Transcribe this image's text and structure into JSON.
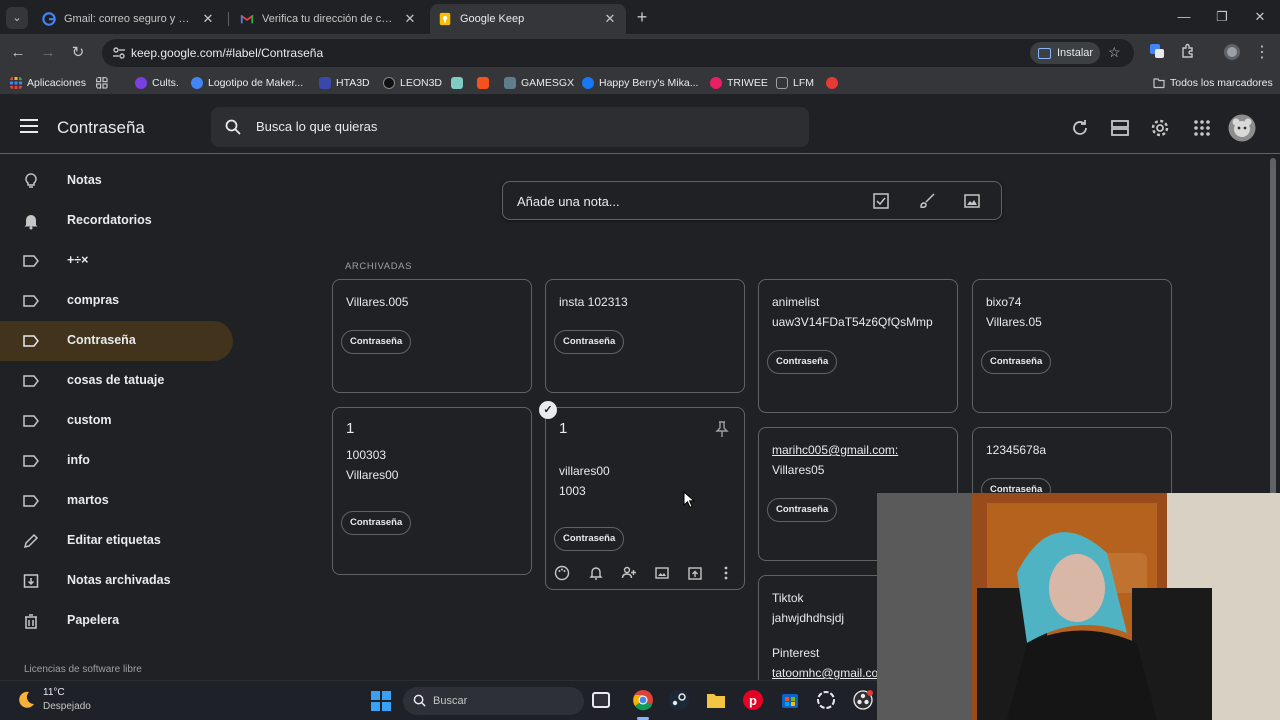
{
  "browser": {
    "tabs": [
      {
        "title": "Gmail: correo seguro y basado",
        "icon": "google-icon"
      },
      {
        "title": "Verifica tu dirección de correo e",
        "icon": "gmail-icon"
      },
      {
        "title": "Google Keep",
        "icon": "keep-icon",
        "active": true
      }
    ],
    "url": "keep.google.com/#label/Contraseña",
    "install_label": "Instalar",
    "bookmarks": [
      {
        "label": "Aplicaciones",
        "icon": "apps-grid-icon"
      },
      {
        "label": "",
        "icon": "grid-icon"
      },
      {
        "label": "Cults.",
        "icon": "cults-icon"
      },
      {
        "label": "Logotipo de Maker...",
        "icon": "maker-icon"
      },
      {
        "label": "HTA3D",
        "icon": "hta3d-icon"
      },
      {
        "label": "LEON3D",
        "icon": "leon3d-icon"
      },
      {
        "label": "",
        "icon": "antenna-icon"
      },
      {
        "label": "",
        "icon": "orange-square-icon"
      },
      {
        "label": "GAMESGX",
        "icon": "gamesgx-icon"
      },
      {
        "label": "Happy Berry's Mika...",
        "icon": "facebook-icon"
      },
      {
        "label": "TRIWEE",
        "icon": "triwee-icon"
      },
      {
        "label": "LFM",
        "icon": "lfm-icon"
      },
      {
        "label": "",
        "icon": "red-circle-icon"
      }
    ],
    "all_bookmarks_label": "Todos los marcadores"
  },
  "keep": {
    "title": "Contraseña",
    "search_placeholder": "Busca lo que quieras",
    "take_note_placeholder": "Añade una nota...",
    "section_label": "ARCHIVADAS",
    "sidebar": [
      {
        "label": "Notas",
        "icon": "lightbulb-icon"
      },
      {
        "label": "Recordatorios",
        "icon": "bell-icon"
      },
      {
        "label": "+÷×",
        "icon": "label-icon"
      },
      {
        "label": "compras",
        "icon": "label-icon"
      },
      {
        "label": "Contraseña",
        "icon": "label-icon",
        "active": true
      },
      {
        "label": "cosas de tatuaje",
        "icon": "label-icon"
      },
      {
        "label": "custom",
        "icon": "label-icon"
      },
      {
        "label": "info",
        "icon": "label-icon"
      },
      {
        "label": "martos",
        "icon": "label-icon"
      },
      {
        "label": "Editar etiquetas",
        "icon": "pencil-icon"
      },
      {
        "label": "Notas archivadas",
        "icon": "archive-icon"
      },
      {
        "label": "Papelera",
        "icon": "trash-icon"
      }
    ],
    "licenses_label": "Licencias de software libre",
    "chip_label": "Contraseña",
    "notes": [
      {
        "title": "",
        "lines": [
          "Villares.005"
        ]
      },
      {
        "title": "",
        "lines": [
          "insta 102313"
        ]
      },
      {
        "title": "",
        "lines": [
          "animelist",
          "uaw3V14FDaT54z6QfQsMmp"
        ]
      },
      {
        "title": "",
        "lines": [
          "bixo74",
          "Villares.05"
        ]
      },
      {
        "title": "1",
        "lines": [
          "100303",
          "Villares00"
        ]
      },
      {
        "title": "1",
        "lines": [
          "villares00",
          "1003"
        ],
        "selected": true
      },
      {
        "title": "",
        "lines": [
          "marihc005@gmail.com:",
          "Villares05"
        ]
      },
      {
        "title": "",
        "lines": [
          "12345678a"
        ]
      },
      {
        "title": "",
        "lines": [
          "Tiktok",
          "jahwjdhdhsjdj",
          "",
          "Pinterest",
          "tatoomhc@gmail.co"
        ]
      }
    ]
  },
  "taskbar": {
    "temperature": "11°C",
    "weather": "Despejado",
    "search_placeholder": "Buscar"
  }
}
